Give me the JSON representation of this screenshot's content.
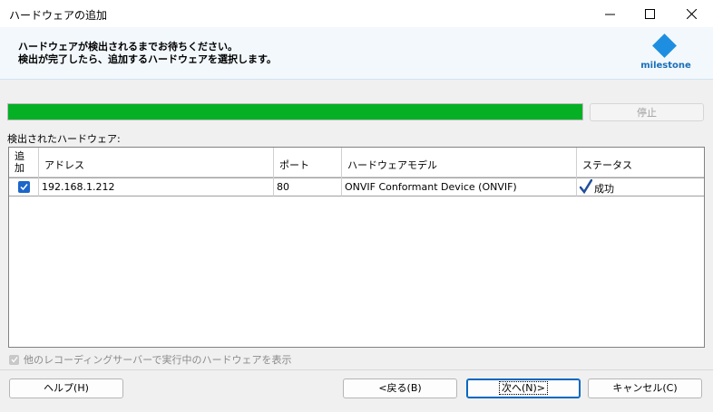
{
  "window": {
    "title": "ハードウェアの追加",
    "minimize_icon": "minimize-icon",
    "maximize_icon": "maximize-icon",
    "close_icon": "close-icon"
  },
  "banner": {
    "line1": "ハードウェアが検出されるまでお待ちください。",
    "line2": "検出が完了したら、追加するハードウェアを選択します。",
    "logo_text": "milestone",
    "logo_color": "#1e8fe0"
  },
  "progress": {
    "value_percent": 100,
    "fill_color": "#06b025",
    "stop_label": "停止"
  },
  "detected_label": "検出されたハードウェア:",
  "table": {
    "headers": {
      "add_line1": "追",
      "add_line2": "加",
      "address": "アドレス",
      "port": "ポート",
      "model": "ハードウェアモデル",
      "status": "ステータス"
    },
    "rows": [
      {
        "checked": true,
        "address": "192.168.1.212",
        "port": "80",
        "model": "ONVIF Conformant Device (ONVIF)",
        "status": "成功",
        "status_icon": "checkmark-icon"
      }
    ]
  },
  "show_other_servers": {
    "label": "他のレコーディングサーバーで実行中のハードウェアを表示",
    "checked": true,
    "disabled": true
  },
  "buttons": {
    "help": "ヘルプ(H)",
    "back": "<戻る(B)",
    "next": "次へ(N)>",
    "cancel": "キャンセル(C)"
  }
}
